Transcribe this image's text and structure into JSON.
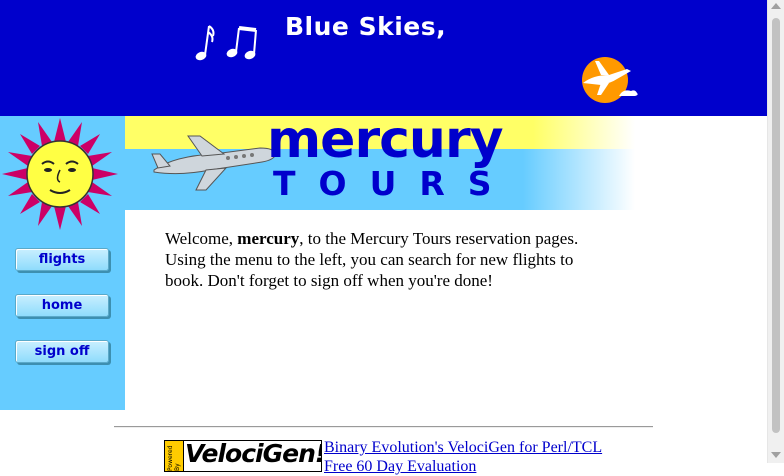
{
  "banner": {
    "title": "Blue Skies,",
    "background": "#0000cc",
    "icons": [
      "music-notes-icon",
      "sun-airplane-icon"
    ]
  },
  "logo": {
    "word1": "mercury",
    "word2": "TOURS",
    "accent_yellow": "#ffff66",
    "accent_cyan": "#66ccff",
    "icons": [
      "sun-face-icon",
      "airplane-icon"
    ]
  },
  "nav": {
    "flights": "flights",
    "home": "home",
    "signoff": "sign off"
  },
  "welcome": {
    "prefix": "Welcome, ",
    "username": "mercury",
    "suffix": ", to the Mercury Tours reservation pages. Using the menu to the left, you can search for new flights to book. Don't forget to sign off when you're done!"
  },
  "footer": {
    "badge_side": "Powered By",
    "badge_text": "VelociGen!",
    "link_text": "Binary Evolution's VelociGen for Perl/TCL",
    "link_text2": "Free 60 Day Evaluation"
  }
}
